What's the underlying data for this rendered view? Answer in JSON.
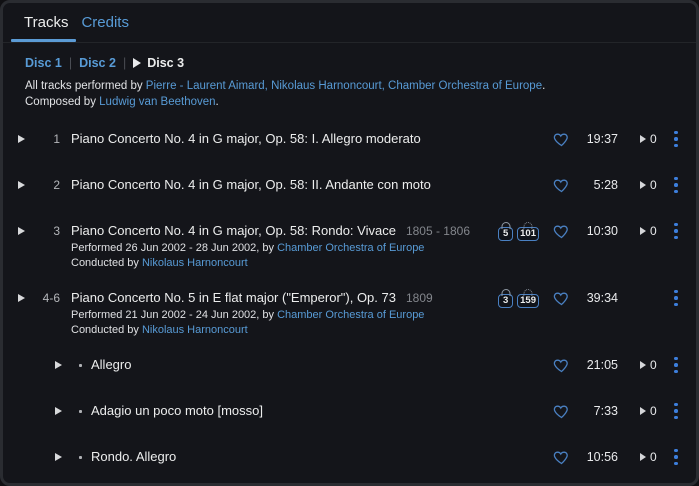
{
  "tabs": [
    {
      "label": "Tracks",
      "active": true
    },
    {
      "label": "Credits",
      "active": false
    }
  ],
  "disc_nav": {
    "links": [
      "Disc 1",
      "Disc 2"
    ],
    "separator": "|",
    "current": "Disc 3"
  },
  "header": {
    "performed_prefix": "All tracks performed by ",
    "performers": "Pierre - Laurent Aimard, Nikolaus Harnoncourt, Chamber Orchestra of Europe",
    "performed_suffix": ".",
    "composed_prefix": "Composed by ",
    "composer": "Ludwig van Beethoven",
    "composed_suffix": "."
  },
  "colors": {
    "background": "#14151a",
    "link_blue": "#589bd6",
    "tab_underline": "#5b9bd5",
    "heart_blue": "#4a80c2",
    "menu_dots_blue": "#3d7fdd",
    "text_primary": "#eceded",
    "text_muted": "#83868c"
  },
  "tracks": [
    {
      "number": "1",
      "title": "Piano Concerto No. 4 in G major, Op. 58: I. Allegro moderato",
      "duration": "19:37",
      "play_count": "0"
    },
    {
      "number": "2",
      "title": "Piano Concerto No. 4 in G major, Op. 58: II. Andante con moto",
      "duration": "5:28",
      "play_count": "0"
    },
    {
      "number": "3",
      "title": "Piano Concerto No. 4 in G major, Op. 58: Rondo: Vivace",
      "year": "1805 - 1806",
      "badges": [
        "5",
        "101"
      ],
      "duration": "10:30",
      "play_count": "0",
      "performed_prefix": "Performed 26 Jun 2002 - 28 Jun 2002, by ",
      "performed_by": "Chamber Orchestra of Europe",
      "conducted_prefix": "Conducted by ",
      "conductor": "Nikolaus Harnoncourt"
    },
    {
      "number": "4-6",
      "title": "Piano Concerto No. 5 in E flat major (\"Emperor\"), Op. 73",
      "year": "1809",
      "badges": [
        "3",
        "159"
      ],
      "duration": "39:34",
      "performed_prefix": "Performed 21 Jun 2002 - 24 Jun 2002, by ",
      "performed_by": "Chamber Orchestra of Europe",
      "conducted_prefix": "Conducted by ",
      "conductor": "Nikolaus Harnoncourt"
    },
    {
      "title": "Allegro",
      "duration": "21:05",
      "play_count": "0"
    },
    {
      "title": "Adagio un poco moto [mosso]",
      "duration": "7:33",
      "play_count": "0"
    },
    {
      "title": "Rondo. Allegro",
      "duration": "10:56",
      "play_count": "0"
    }
  ]
}
